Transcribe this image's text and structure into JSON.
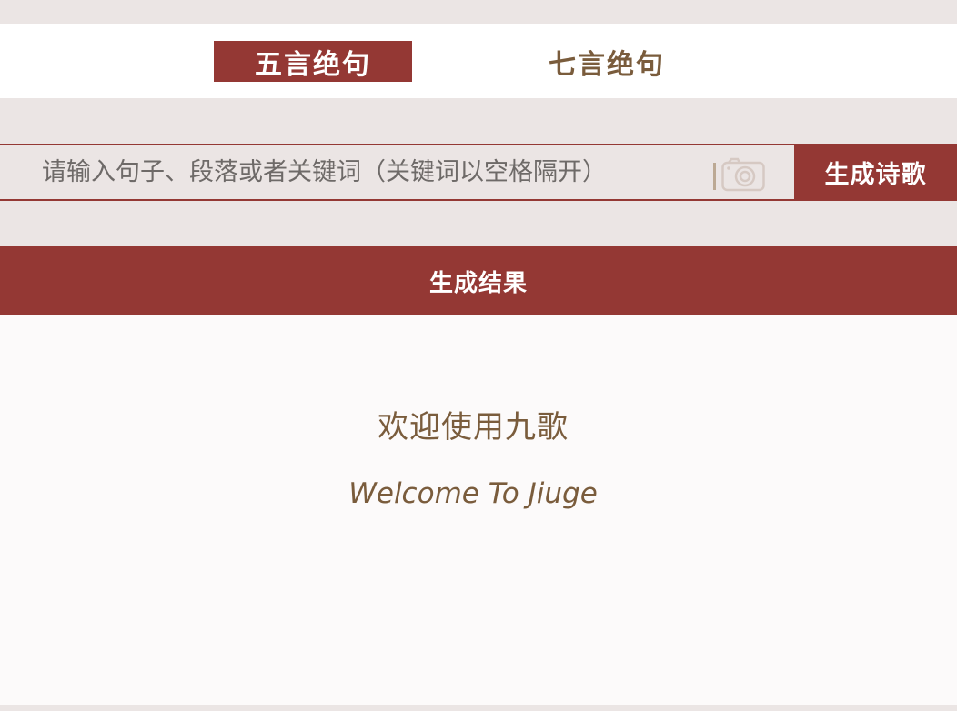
{
  "tabs": [
    {
      "label": "五言绝句",
      "active": true
    },
    {
      "label": "七言绝句",
      "active": false
    }
  ],
  "search": {
    "placeholder": "请输入句子、段落或者关键词（关键词以空格隔开）",
    "value": "",
    "camera_icon": "camera-icon"
  },
  "generate_button": {
    "label": "生成诗歌"
  },
  "result": {
    "header": "生成结果",
    "welcome_cn": "欢迎使用九歌",
    "welcome_en": "Welcome To Jiuge"
  },
  "colors": {
    "accent": "#943834",
    "text_brown": "#7a5c3c",
    "background": "#ebe5e4",
    "panel": "#fcfafa"
  }
}
